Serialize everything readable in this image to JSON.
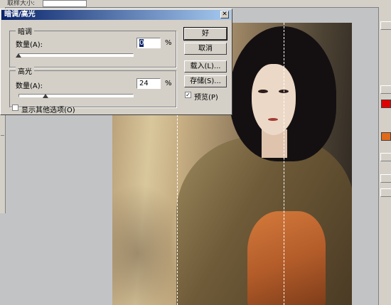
{
  "topbar": {
    "label": "取样大小:"
  },
  "dialog": {
    "title": "暗调/高光",
    "close_glyph": "✕",
    "shadows": {
      "group_label": "暗调",
      "amount_label": "数量(A):",
      "value": "0",
      "unit": "%",
      "slider_fraction": 0.0
    },
    "highlights": {
      "group_label": "高光",
      "amount_label": "数量(A):",
      "value": "24",
      "unit": "%",
      "slider_fraction": 0.24
    },
    "more_options_label": "显示其他选项(O)",
    "more_options_checked": false
  },
  "buttons": {
    "ok": "好",
    "cancel": "取消",
    "load": "载入(L)...",
    "save": "存储(S)...",
    "preview": "预览(P)",
    "preview_checked": true
  },
  "canvas": {
    "photo_subject": "woman in traditional robe",
    "selection": "dashed marquee guides"
  },
  "colors": {
    "dialog_bg": "#d4d0c8",
    "title_start": "#0a246a",
    "title_end": "#a6caf0",
    "foreground_swatch": "#e00000",
    "background_swatch": "#e06a1a"
  }
}
